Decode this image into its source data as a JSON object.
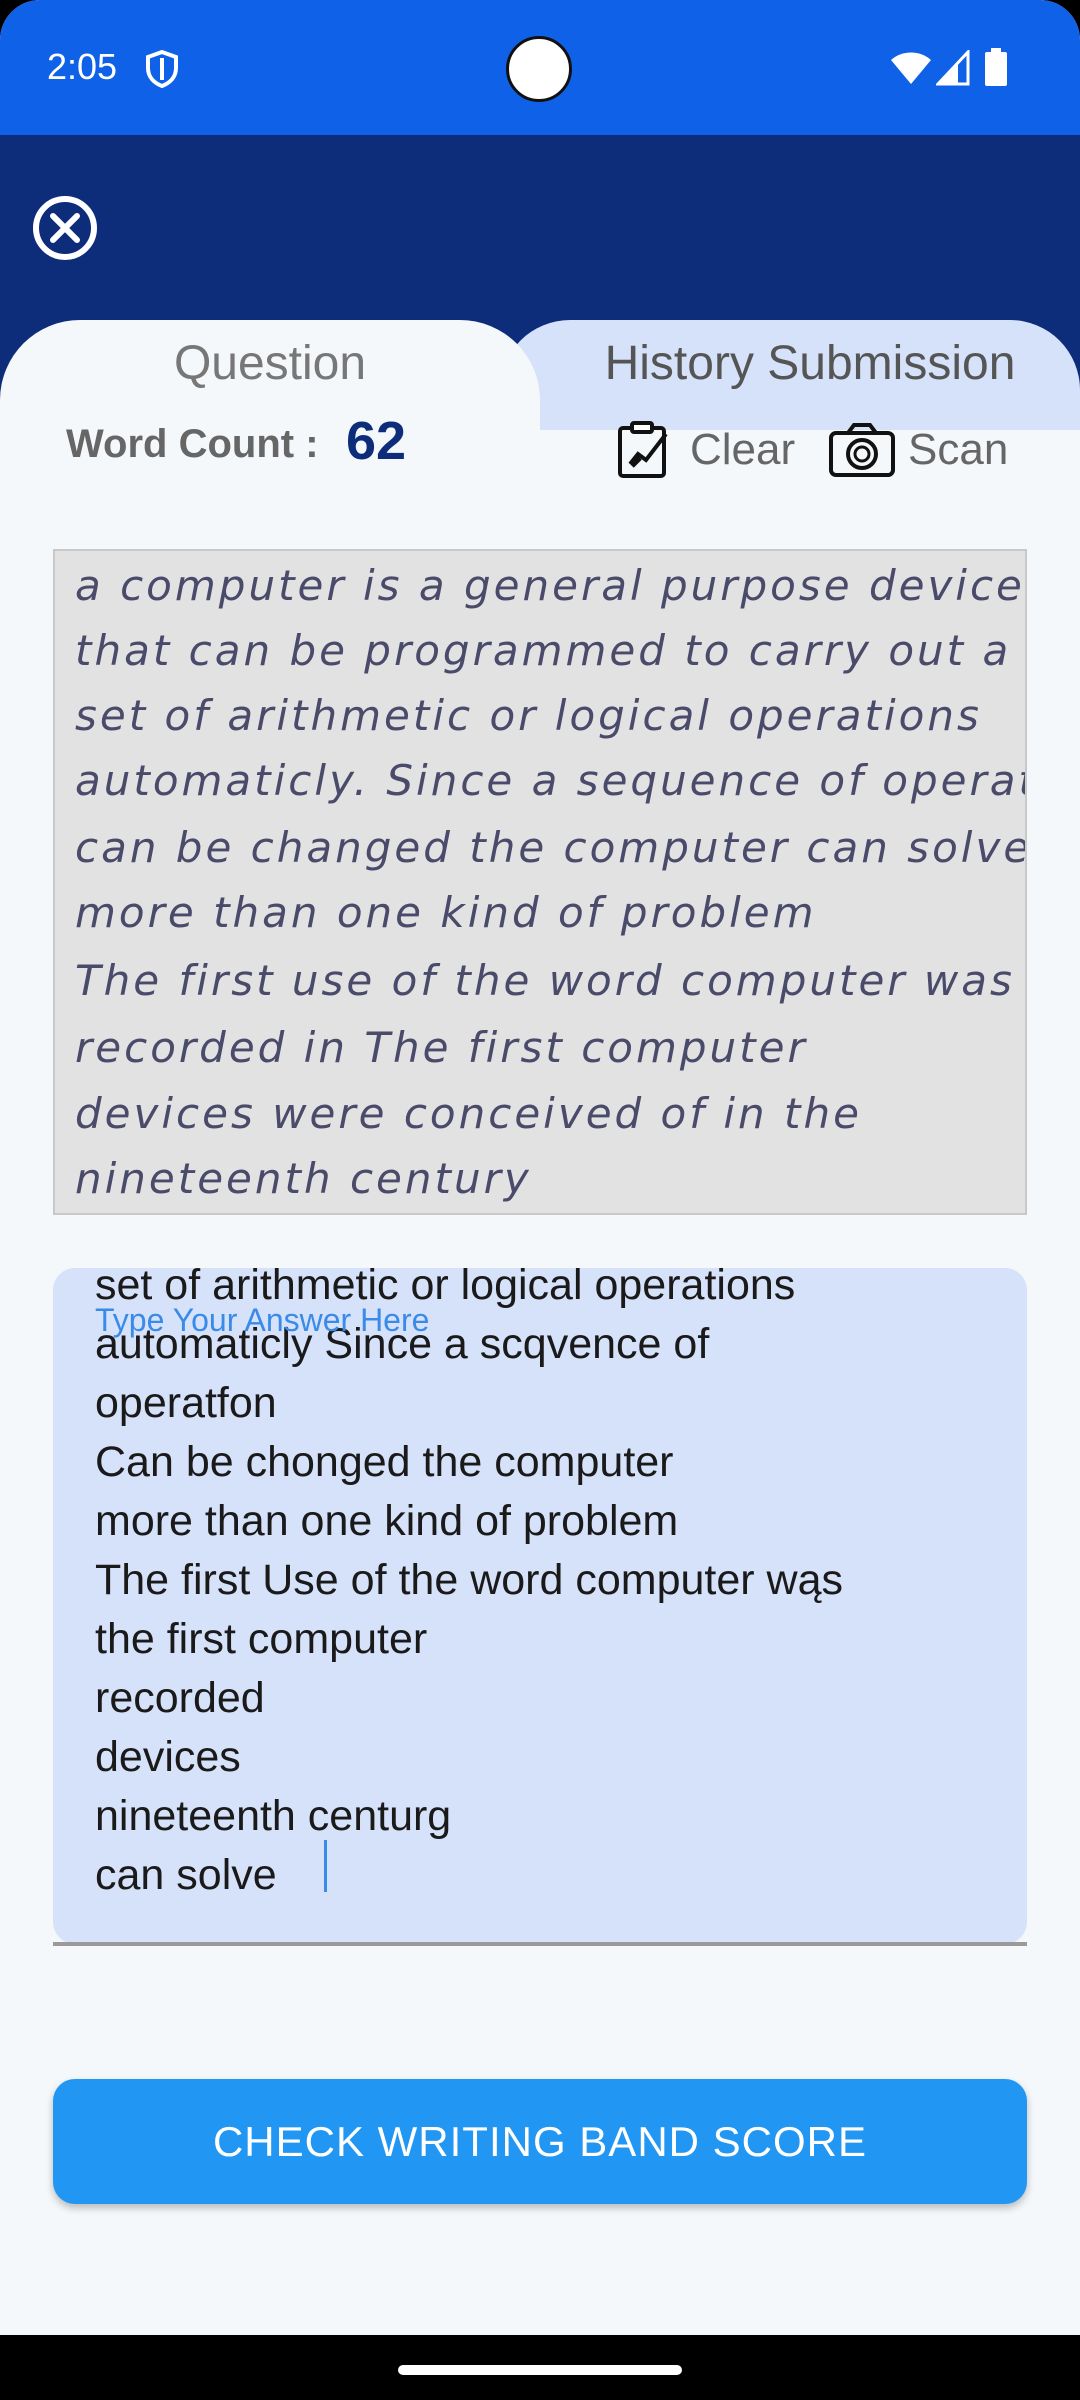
{
  "status": {
    "time": "2:05",
    "icons": [
      "shield-icon",
      "wifi-icon",
      "signal-icon",
      "battery-icon"
    ]
  },
  "header": {
    "close_icon": "close-circle-icon"
  },
  "tabs": [
    {
      "label": "Question",
      "active": true
    },
    {
      "label": "History Submission",
      "active": false
    }
  ],
  "toolbar": {
    "word_count_label": "Word Count :",
    "word_count_value": "62",
    "clear_label": "Clear",
    "scan_label": "Scan"
  },
  "scan": {
    "lines": [
      "a computer is a general purpose device",
      "that can be programmed to carry out a",
      "set of arithmetic or logical operations",
      "automaticly. Since a sequence of operation",
      "can be changed the computer can solve",
      "more than one kind of problem",
      "The first use of the word computer was",
      "recorded in      The first computer",
      "devices were conceived of in the",
      "nineteenth century"
    ]
  },
  "answer": {
    "placeholder": "Type Your Answer Here",
    "text": "set of arithmetic or logical operations\nautomaticly Since a scqvence of\noperatfon\nCan be chonged the computer\nmore than one kind of problem\nThe first Use of the word computer wąs\nthe first computer\nrecorded\ndevices\nnineteenth centurg\ncan solve"
  },
  "actions": {
    "check_label": "CHECK WRITING BAND SCORE"
  },
  "colors": {
    "status_bar": "#0f62e8",
    "header": "#0d2c7a",
    "accent": "#2196f3",
    "answer_bg": "#d6e1fa"
  }
}
